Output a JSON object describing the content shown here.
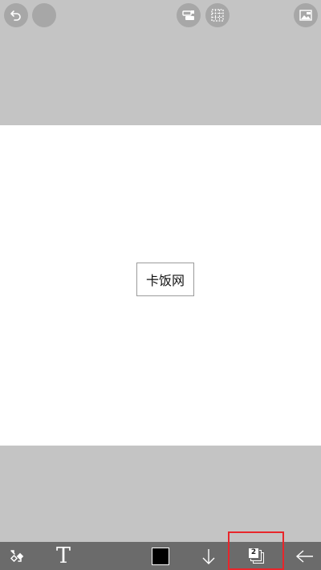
{
  "top_bar": {
    "buttons": [
      {
        "name": "undo",
        "icon": "undo-icon"
      },
      {
        "name": "redo",
        "icon": "blank-circle-icon"
      },
      {
        "name": "image-adjust",
        "icon": "image-adjust-icon"
      },
      {
        "name": "selection",
        "icon": "selection-grid-icon"
      },
      {
        "name": "photo",
        "icon": "photo-icon"
      }
    ]
  },
  "canvas": {
    "text_layer": "卡饭网"
  },
  "toolbar": {
    "layers_count": "2",
    "brush_color": "#000000",
    "highlight_color": "#e8262b",
    "icons": [
      "transform-icon",
      "text-tool-icon",
      "color-swatch",
      "arrow-down-icon",
      "layers-icon",
      "back-arrow-icon"
    ]
  }
}
